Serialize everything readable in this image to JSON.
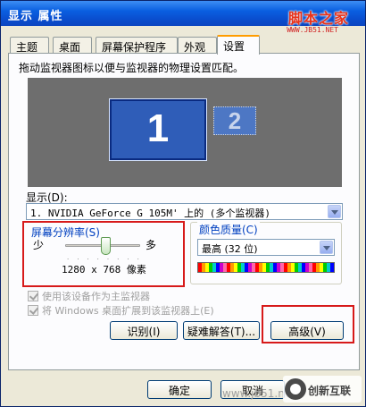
{
  "window": {
    "title": "显示 属性"
  },
  "logo": {
    "text": "脚本之家",
    "url": "WWW.JB51.NET"
  },
  "tabs": [
    {
      "label": "主题"
    },
    {
      "label": "桌面"
    },
    {
      "label": "屏幕保护程序"
    },
    {
      "label": "外观"
    },
    {
      "label": "设置",
      "active": true
    }
  ],
  "instruction": "拖动监视器图标以便与监视器的物理设置匹配。",
  "monitors": {
    "primary": "1",
    "secondary": "2"
  },
  "display": {
    "label": "显示(D):",
    "value": "1. NVIDIA GeForce G 105M' 上的 (多个监视器)"
  },
  "resolution": {
    "title": "屏幕分辨率(S)",
    "less": "少",
    "more": "多",
    "value": "1280 x 768 像素",
    "slider_fraction": 0.55
  },
  "color_quality": {
    "title": "颜色质量(C)",
    "value": "最高 (32 位)"
  },
  "checkboxes": [
    {
      "label": "使用该设备作为主监视器",
      "checked": true,
      "enabled": false
    },
    {
      "label": "将 Windows 桌面扩展到该监视器上(E)",
      "checked": true,
      "enabled": false
    }
  ],
  "buttons": {
    "identify": "识别(I)",
    "troubleshoot": "疑难解答(T)...",
    "advanced": "高级(V)",
    "ok": "确定",
    "cancel": "取消"
  },
  "watermark": {
    "url": "www.jb51.net",
    "brand": "创新互联"
  }
}
